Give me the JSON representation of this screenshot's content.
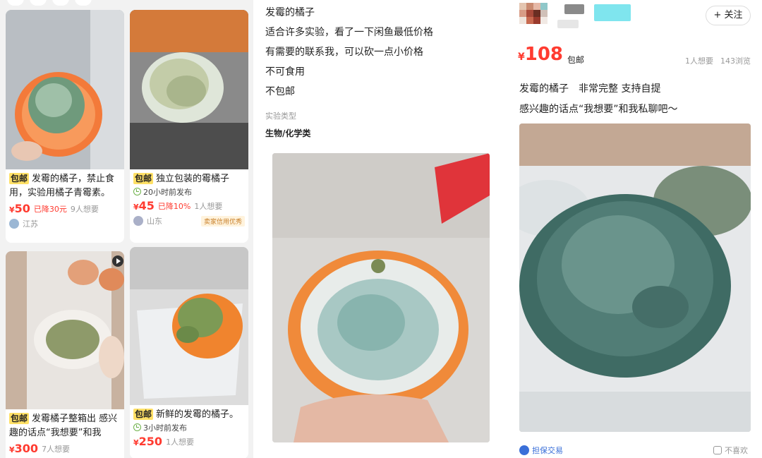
{
  "panel1": {
    "cards": [
      {
        "badge": "包邮",
        "title": "发霉的橘子，禁止食用，实验用橘子青霉素。",
        "price": "50",
        "drop": "已降30元",
        "wants": "9人想要",
        "loc": "江苏"
      },
      {
        "badge": "包邮",
        "title": "独立包装的霉橘子",
        "time": "20小时前发布",
        "price": "45",
        "drop": "已降10%",
        "wants": "1人想要",
        "loc": "山东",
        "tag": "卖家信用优秀"
      },
      {
        "badge": "包邮",
        "title": "发霉橘子整箱出 感兴趣的话点“我想要”和我",
        "price": "300",
        "wants": "7人想要"
      },
      {
        "badge": "包邮",
        "title": "新鲜的发霉的橘子。",
        "time": "3小时前发布",
        "price": "250",
        "wants": "1人想要"
      }
    ]
  },
  "panel2": {
    "desc": [
      "发霉的橘子",
      "适合许多实验，看了一下闲鱼最低价格",
      "有需要的联系我，可以砍一点小价格",
      "不可食用",
      "不包邮"
    ],
    "type_label": "实验类型",
    "type_value": "生物/化学类"
  },
  "panel3": {
    "follow": "+ 关注",
    "price": "108",
    "currency": "¥",
    "shipping": "包邮",
    "wants": "1人想要",
    "views": "143浏览",
    "desc": [
      "发霉的橘子　非常完整 支持自提",
      "感兴趣的话点“我想要”和我私聊吧～"
    ],
    "guarantee": "担保交易",
    "dislike": "不喜欢"
  },
  "currency": "¥",
  "colors": {
    "price": "#ff3b30",
    "badge": "#ffe066",
    "link": "#3a6fd8"
  }
}
